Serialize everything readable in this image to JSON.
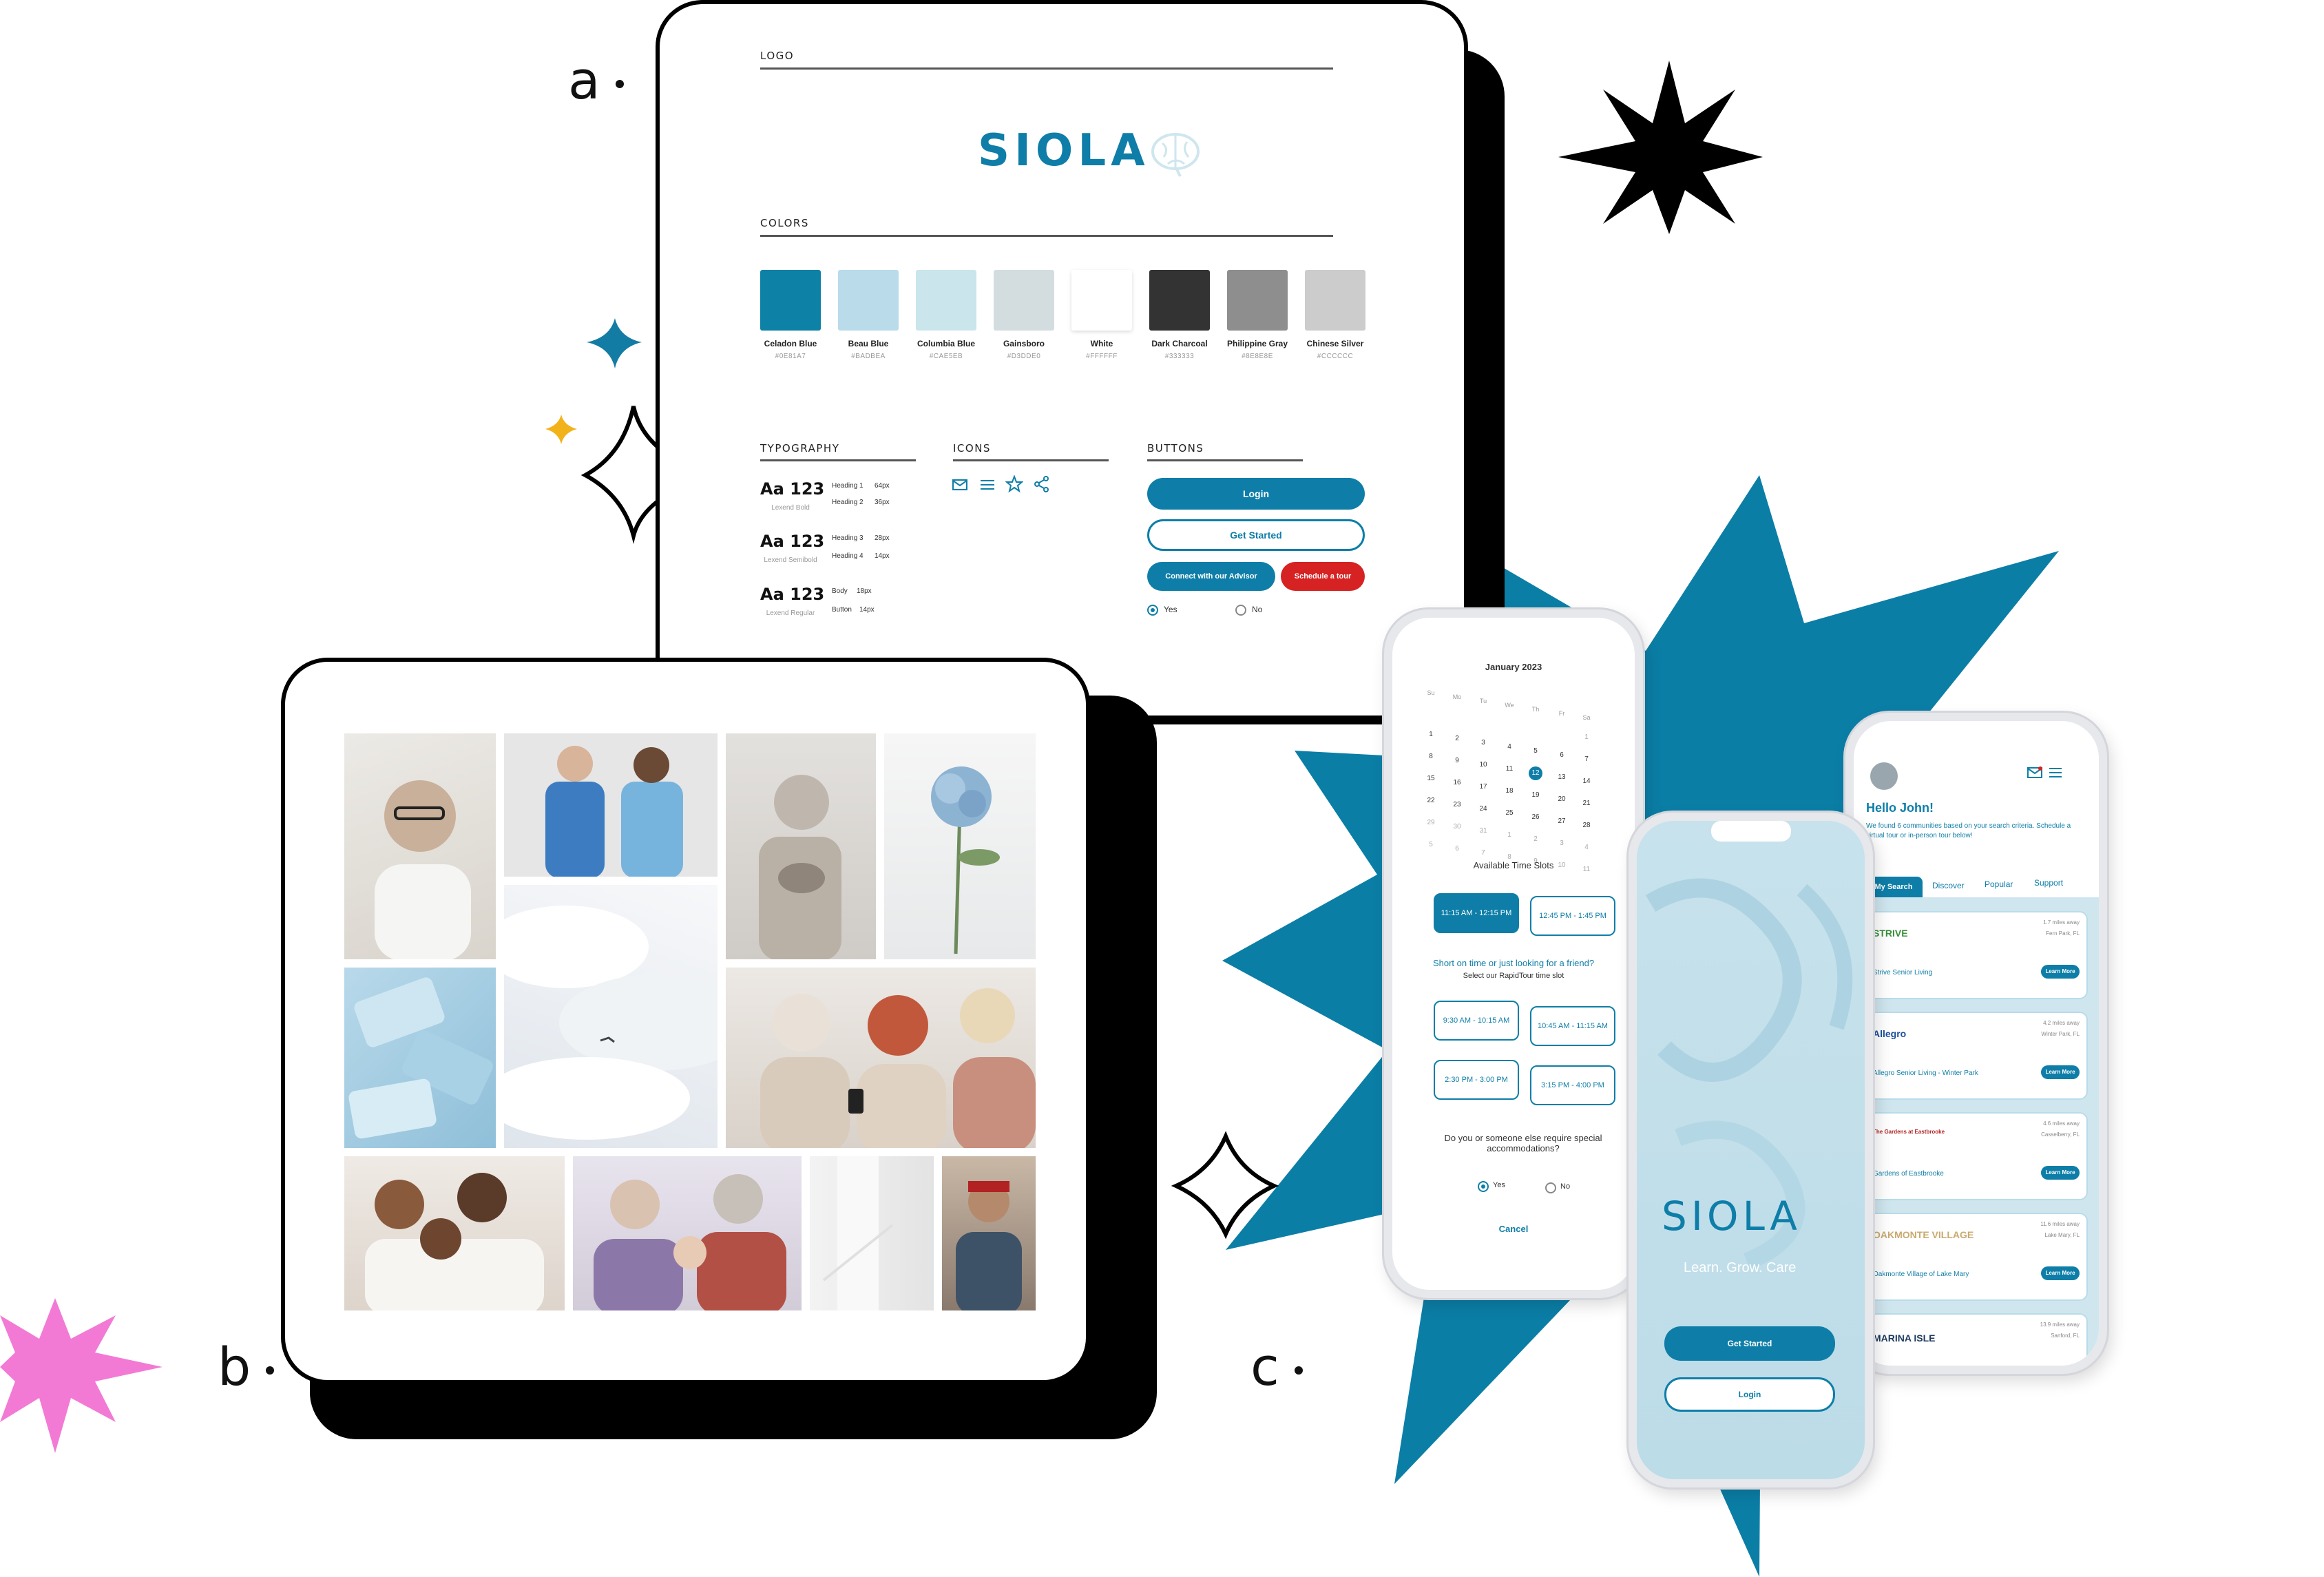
{
  "sections": {
    "a": "a",
    "b": "b",
    "c": "c"
  },
  "style_guide": {
    "logo_label": "LOGO",
    "logo_text": "SIOLA",
    "colors_label": "COLORS",
    "colors": [
      {
        "name": "Celadon Blue",
        "hex": "#0E81A7"
      },
      {
        "name": "Beau Blue",
        "hex": "#BADBEA"
      },
      {
        "name": "Columbia Blue",
        "hex": "#CAE5EB"
      },
      {
        "name": "Gainsboro",
        "hex": "#D3DDE0"
      },
      {
        "name": "White",
        "hex": "#FFFFFF"
      },
      {
        "name": "Dark Charcoal",
        "hex": "#333333"
      },
      {
        "name": "Philippine Gray",
        "hex": "#8E8E8E"
      },
      {
        "name": "Chinese Silver",
        "hex": "#CCCCCC"
      }
    ],
    "typography_label": "TYPOGRAPHY",
    "typography": [
      {
        "sample": "Aa 123",
        "font": "Lexend Bold",
        "rows": [
          [
            "Heading 1",
            "64px"
          ],
          [
            "Heading 2",
            "36px"
          ]
        ]
      },
      {
        "sample": "Aa 123",
        "font": "Lexend Semibold",
        "rows": [
          [
            "Heading 3",
            "28px"
          ],
          [
            "Heading 4",
            "14px"
          ]
        ]
      },
      {
        "sample": "Aa 123",
        "font": "Lexend Regular",
        "rows": [
          [
            "Body",
            "18px"
          ],
          [
            "Button",
            "14px"
          ]
        ]
      }
    ],
    "icons_label": "ICONS",
    "buttons_label": "BUTTONS",
    "buttons": {
      "login": "Login",
      "get_started": "Get Started",
      "advisor": "Connect with our Advisor",
      "tour": "Schedule a tour",
      "yes": "Yes",
      "no": "No"
    }
  },
  "phone_calendar": {
    "month": "January 2023",
    "days_of_week": [
      "Su",
      "Mo",
      "Tu",
      "We",
      "Th",
      "Fr",
      "Sa"
    ],
    "weeks": [
      [
        "",
        "",
        "",
        "",
        "",
        "",
        "1"
      ],
      [
        "1",
        "2",
        "3",
        "4",
        "5",
        "6",
        "7"
      ],
      [
        "8",
        "9",
        "10",
        "11",
        "12",
        "13",
        "14"
      ],
      [
        "15",
        "16",
        "17",
        "18",
        "19",
        "20",
        "21"
      ],
      [
        "22",
        "23",
        "24",
        "25",
        "26",
        "27",
        "28"
      ],
      [
        "29",
        "30",
        "31",
        "1",
        "2",
        "3",
        "4"
      ],
      [
        "5",
        "6",
        "7",
        "8",
        "9",
        "10",
        "11"
      ]
    ],
    "selected_day": "12",
    "available_label": "Available Time Slots",
    "slots_top": [
      "11:15 AM - 12:15 PM",
      "12:45 PM - 1:45 PM"
    ],
    "short_on_time": "Short on time or just looking for a friend?",
    "rapid_tour": "Select our RapidTour time slot",
    "slots_rapid": [
      "9:30 AM - 10:15 AM",
      "10:45 AM - 11:15 AM",
      "2:30 PM - 3:00 PM",
      "3:15 PM - 4:00 PM"
    ],
    "question": "Do you or someone else require special accommodations?",
    "yes": "Yes",
    "no": "No",
    "cancel": "Cancel"
  },
  "phone_splash": {
    "title": "SIOLA",
    "tagline": "Learn. Grow. Care",
    "get_started": "Get Started",
    "login": "Login"
  },
  "phone_search": {
    "greeting": "Hello John!",
    "intro": "We found 6 communities based on your search criteria. Schedule a virtual tour or in-person tour below!",
    "tabs": [
      "My Search",
      "Discover",
      "Popular",
      "Support"
    ],
    "communities": [
      {
        "logo": "STRIVE",
        "name": "Strive Senior Living",
        "distance": "1.7 miles away",
        "city": "Fern Park, FL",
        "button": "Learn More"
      },
      {
        "logo": "Allegro",
        "name": "Allegro Senior Living - Winter Park",
        "distance": "4.2 miles away",
        "city": "Winter Park, FL",
        "button": "Learn More"
      },
      {
        "logo": "The Gardens at Eastbrooke",
        "name": "Gardens of Eastbrooke",
        "distance": "4.6 miles away",
        "city": "Casselberry, FL",
        "button": "Learn More"
      },
      {
        "logo": "OAKMONTE VILLAGE",
        "name": "Oakmonte Village of Lake Mary",
        "distance": "11.6 miles away",
        "city": "Lake Mary, FL",
        "button": "Learn More"
      },
      {
        "logo": "MARINA ISLE",
        "name": "",
        "distance": "13.9 miles away",
        "city": "Sanford, FL",
        "button": ""
      }
    ]
  }
}
